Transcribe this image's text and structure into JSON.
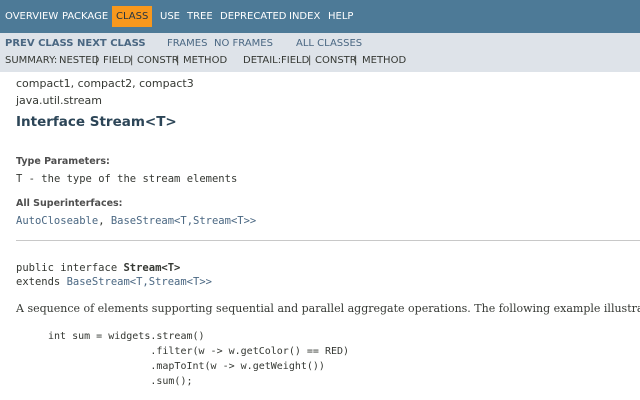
{
  "top_nav": [
    "OVERVIEW",
    "PACKAGE",
    "CLASS",
    "USE",
    "TREE",
    "DEPRECATED",
    "INDEX",
    "HELP"
  ],
  "sub_nav": {
    "prev_class": "PREV CLASS",
    "next_class": "NEXT CLASS",
    "frames": "FRAMES",
    "no_frames": "NO FRAMES",
    "all_classes": "ALL CLASSES",
    "summary_label": "SUMMARY:",
    "summary_items": [
      "NESTED",
      "FIELD",
      "CONSTR",
      "METHOD"
    ],
    "detail_label": "DETAIL:",
    "detail_items": [
      "FIELD",
      "CONSTR",
      "METHOD"
    ],
    "sep": "|"
  },
  "header": {
    "profiles": "compact1, compact2, compact3",
    "package": "java.util.stream",
    "title": "Interface Stream<T>"
  },
  "type_params": {
    "label": "Type Parameters:",
    "param": "T",
    "dash": " - ",
    "desc": "the type of the stream elements"
  },
  "superinterfaces": {
    "label": "All Superinterfaces:",
    "items": [
      "AutoCloseable",
      "BaseStream<T,Stream<T>>"
    ],
    "sep": ", "
  },
  "signature": {
    "prefix": "public interface ",
    "name": "Stream<T>",
    "extends_kw": "extends ",
    "extends_link": "BaseStream<T,Stream<T>>"
  },
  "description": "A sequence of elements supporting sequential and parallel aggregate operations. The following example illustrates",
  "code_lines": [
    "int sum = widgets.stream()",
    "                 .filter(w -> w.getColor() == RED)",
    "                 .mapToInt(w -> w.getWeight())",
    "                 .sum();"
  ],
  "colors": {
    "nav_bg": "#4d7a97",
    "active_tab": "#f8981d",
    "subnav_bg": "#dee3e9",
    "link": "#4a6782"
  }
}
